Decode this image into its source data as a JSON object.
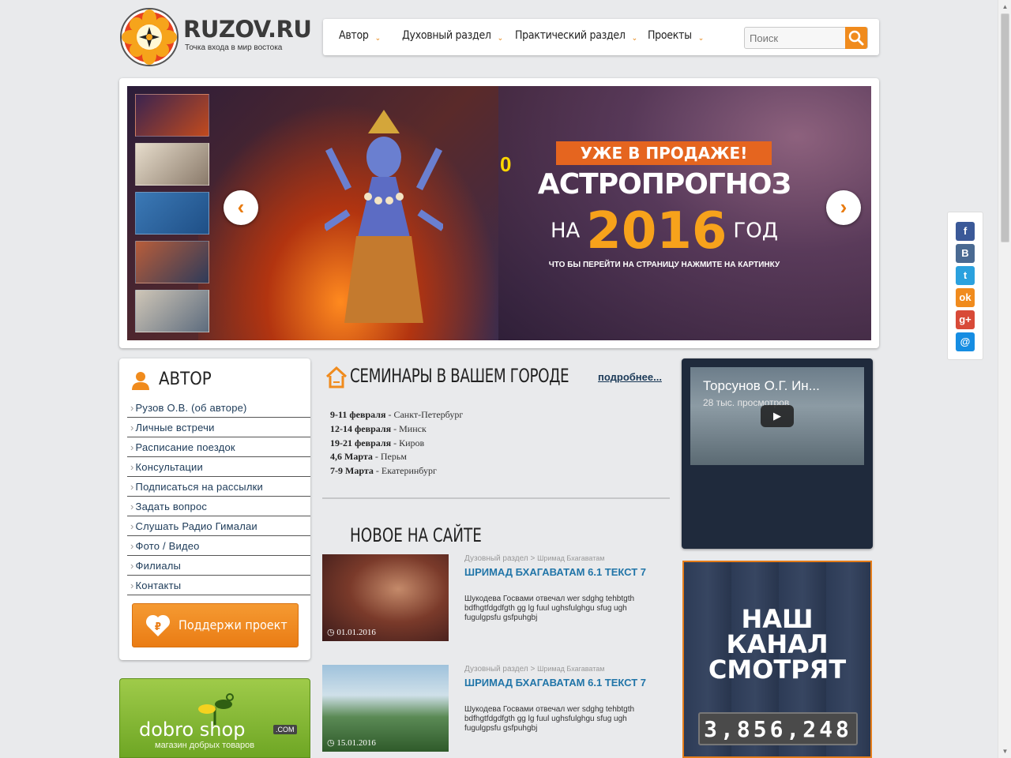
{
  "header": {
    "site_name": "RUZOV.RU",
    "tagline": "Точка входа в мир востока"
  },
  "nav": {
    "items": [
      {
        "label": "Автор"
      },
      {
        "label": "Духовный раздел"
      },
      {
        "label": "Практический раздел"
      },
      {
        "label": "Проекты"
      }
    ],
    "search_placeholder": "Поиск"
  },
  "slider": {
    "badge": "УЖЕ В ПРОДАЖЕ!",
    "title": "АСТРОПРОГНОЗ",
    "pre": "НА",
    "year": "2016",
    "post": "ГОД",
    "sub": "ЧТО БЫ ПЕРЕЙТИ НА СТРАНИЦУ НАЖМИТЕ НА КАРТИНКУ",
    "counter_zero": "0",
    "prev": "‹",
    "next": "›"
  },
  "author": {
    "title": "АВТОР",
    "menu": [
      {
        "label": "Рузов О.В. (об авторе)"
      },
      {
        "label": "Личные встречи"
      },
      {
        "label": "Расписание поездок"
      },
      {
        "label": "Консультации"
      },
      {
        "label": "Подписаться на рассылки"
      },
      {
        "label": "Задать вопрос"
      },
      {
        "label": "Слушать Радио Гималаи"
      },
      {
        "label": "Фото / Видео"
      },
      {
        "label": "Филиалы"
      },
      {
        "label": "Контакты"
      }
    ],
    "donate_label": "Поддержи проект"
  },
  "shop": {
    "name": "dobro  shop",
    "com": ".COM",
    "sub": "магазин добрых товаров"
  },
  "seminars": {
    "title": "СЕМИНАРЫ В ВАШЕМ ГОРОДЕ",
    "more": "подробнее...",
    "items": [
      {
        "date": "9-11 февраля",
        "city": " - Санкт-Петербург"
      },
      {
        "date": "12-14 февраля",
        "city": " - Минск"
      },
      {
        "date": "19-21 февраля",
        "city": " - Киров"
      },
      {
        "date": "4,6 Марта",
        "city": " - Перьм"
      },
      {
        "date": "7-9 Марта",
        "city": " - Екатеринбург"
      }
    ]
  },
  "new_on_site": {
    "title": "НОВОЕ НА САЙТЕ",
    "articles": [
      {
        "crumb_section": "Дузовный раздел",
        "crumb_sub": "Шримад Бхагаватам",
        "title": "ШРИМАД БХАГАВАТАМ 6.1 ТЕКСТ 7",
        "text": "Шукодева Госвами отвечал wer sdghg tehbtgth bdfhgtfdgdfgth gg lg fuul ughsfulghgu sfug ugh fugulgpsfu gsfpuhgbj",
        "date": "01.01.2016"
      },
      {
        "crumb_section": "Дузовный раздел",
        "crumb_sub": "Шримад Бхагаватам",
        "title": "ШРИМАД БХАГАВАТАМ 6.1 ТЕКСТ 7",
        "text": "Шукодева Госвами отвечал wer sdghg tehbtgth bdfhgtfdgdfgth gg lg fuul ughsfulghgu sfug ugh fugulgpsfu gsfpuhgbj",
        "date": "15.01.2016"
      }
    ]
  },
  "video": {
    "title": "Торсунов О.Г. Ин...",
    "views": "28 тыс. просмотров"
  },
  "channel": {
    "line1": "НАШ",
    "line2": "КАНАЛ",
    "line3": "СМОТРЯТ",
    "counter": "3,856,248"
  },
  "colors": {
    "accent": "#f08b1d",
    "link": "#2175a8",
    "menu_text": "#1c3a58"
  }
}
